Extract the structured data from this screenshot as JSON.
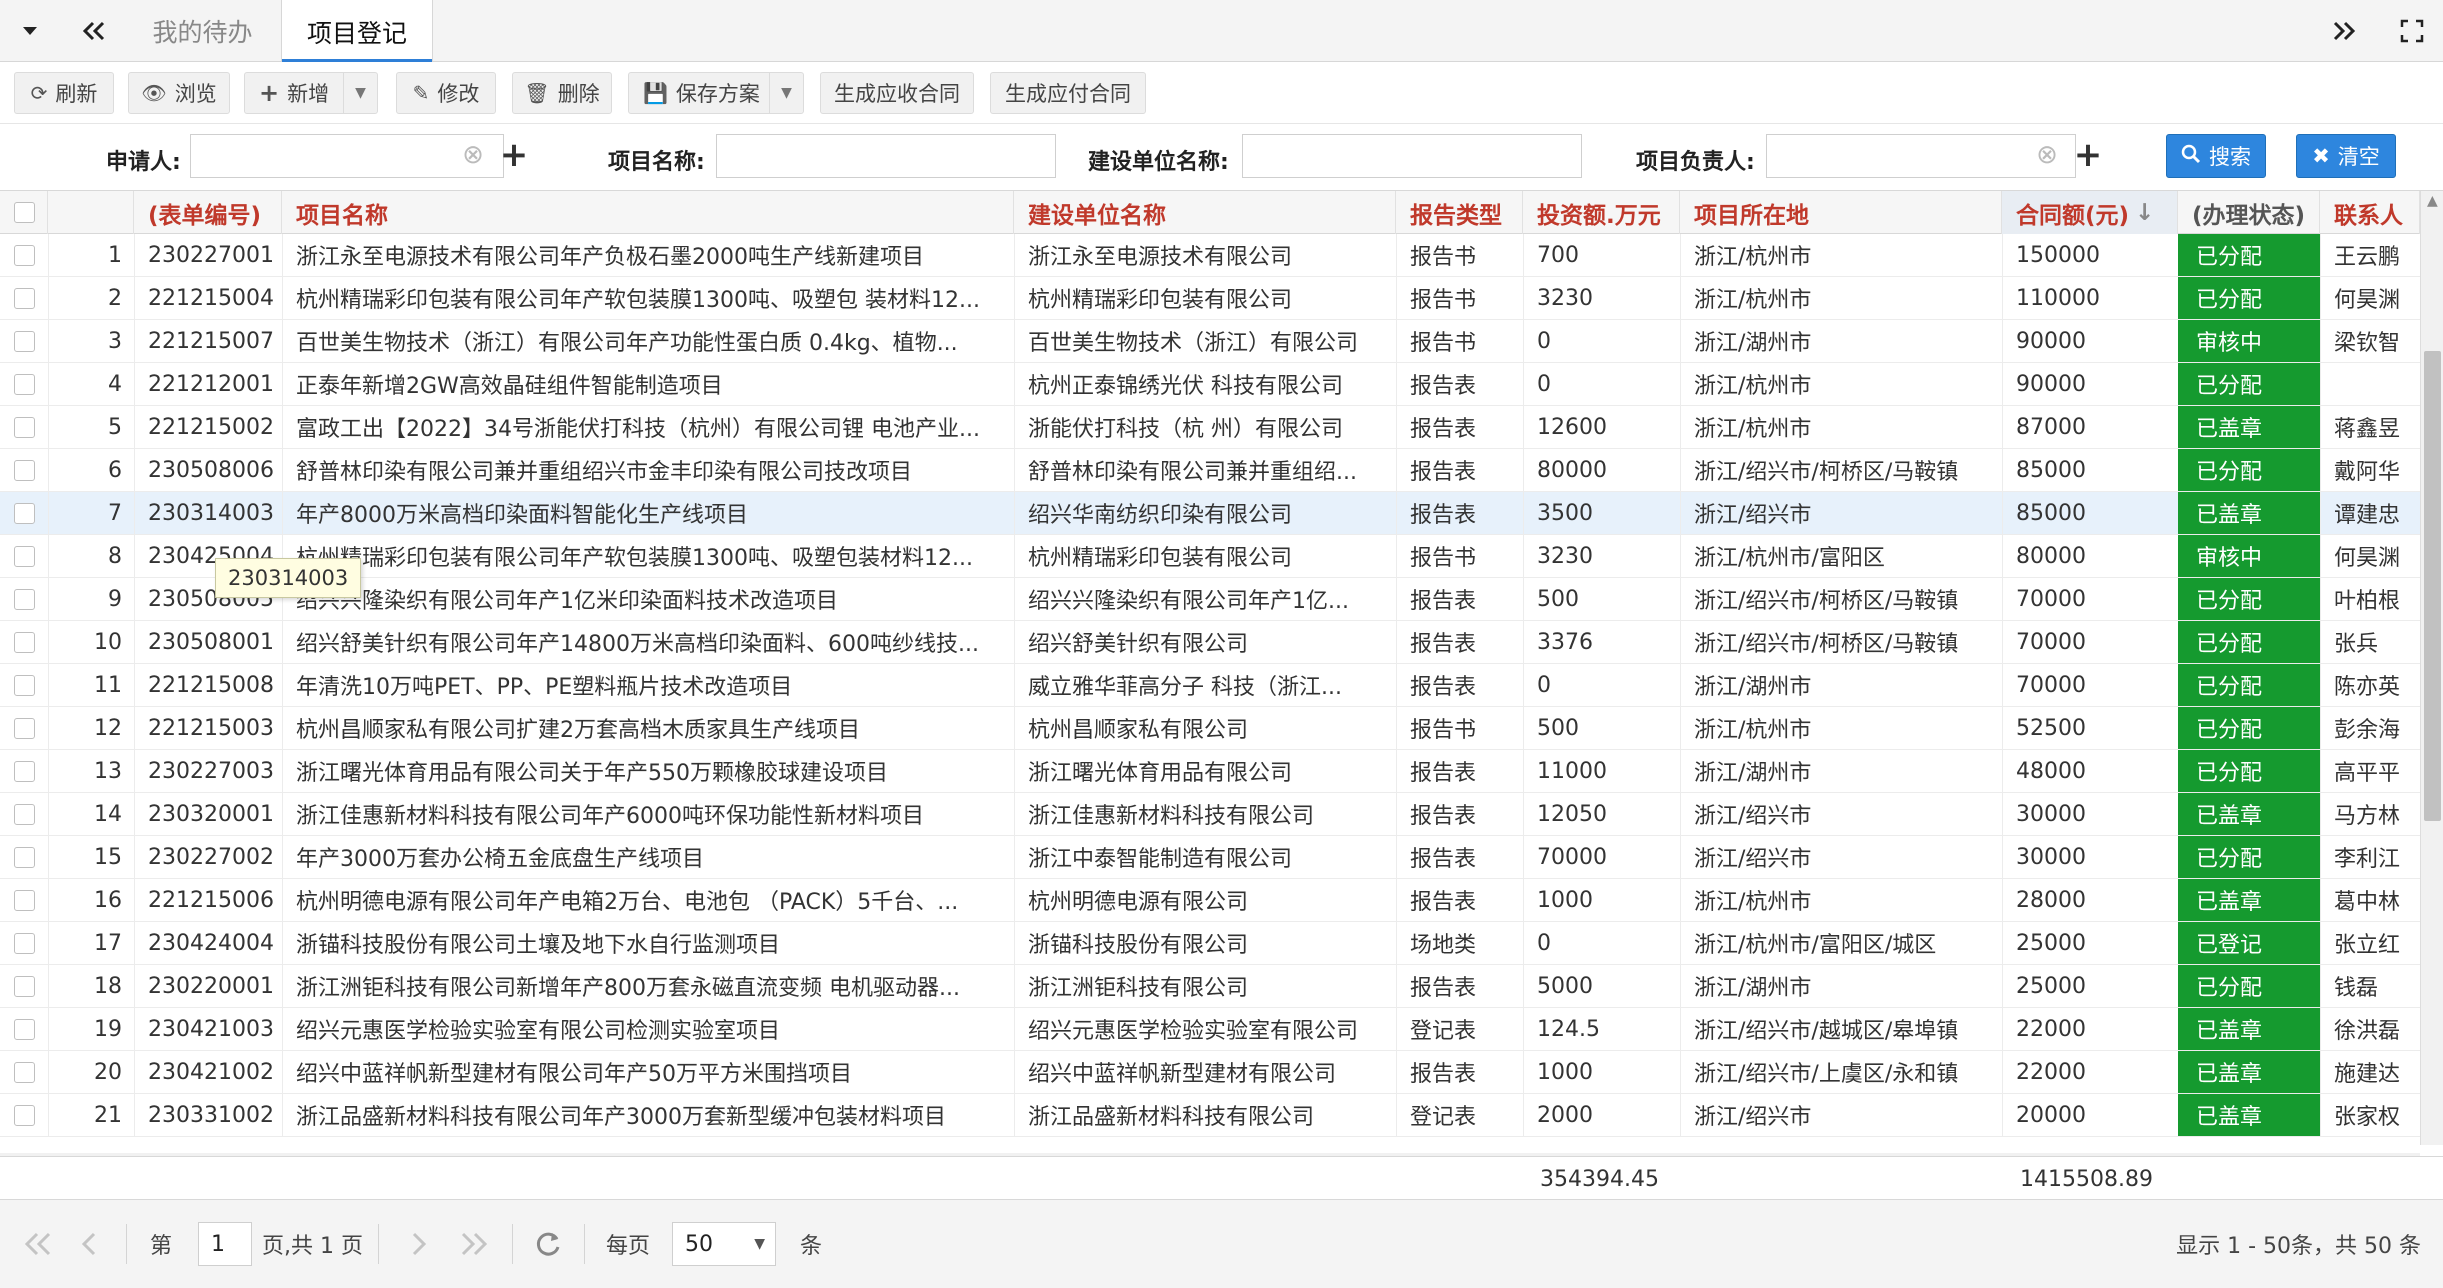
{
  "tabbar": {
    "left_icons": [
      "chevron-down-icon",
      "double-chevron-left-icon"
    ],
    "tabs": [
      {
        "label": "我的待办",
        "active": false
      },
      {
        "label": "项目登记",
        "active": true
      }
    ],
    "right_icons": [
      "double-chevron-right-icon",
      "fullscreen-icon"
    ]
  },
  "toolbar": {
    "refresh": "刷新",
    "browse": "浏览",
    "add": "新增",
    "edit": "修改",
    "delete": "删除",
    "save_plan": "保存方案",
    "gen_receivable": "生成应收合同",
    "gen_payable": "生成应付合同"
  },
  "search": {
    "applicant_label": "申请人:",
    "applicant_value": "",
    "project_name_label": "项目名称:",
    "project_name_value": "",
    "unit_name_label": "建设单位名称:",
    "unit_name_value": "",
    "manager_label": "项目负责人:",
    "manager_value": "",
    "search_btn": "搜索",
    "clear_btn": "清空"
  },
  "grid": {
    "columns": [
      "(表单编号)",
      "项目名称",
      "建设单位名称",
      "报告类型",
      "投资额.万元",
      "项目所在地",
      "合同额(元)",
      "(办理状态)",
      "联系人"
    ],
    "sort_indicator": "↓",
    "status_color": "#159a2f",
    "rows": [
      {
        "idx": "1",
        "code": "230227001",
        "name": "浙江永至电源技术有限公司年产负极石墨2000吨生产线新建项目",
        "unit": "浙江永至电源技术有限公司",
        "type": "报告书",
        "invest": "700",
        "loc": "浙江/杭州市",
        "amount": "150000",
        "status": "已分配",
        "contact": "王云鹏"
      },
      {
        "idx": "2",
        "code": "221215004",
        "name": "杭州精瑞彩印包装有限公司年产软包装膜1300吨、吸塑包 装材料12...",
        "unit": "杭州精瑞彩印包装有限公司",
        "type": "报告书",
        "invest": "3230",
        "loc": "浙江/杭州市",
        "amount": "110000",
        "status": "已分配",
        "contact": "何昊渊"
      },
      {
        "idx": "3",
        "code": "221215007",
        "name": "百世美生物技术（浙江）有限公司年产功能性蛋白质 0.4kg、植物...",
        "unit": "百世美生物技术（浙江）有限公司",
        "type": "报告书",
        "invest": "0",
        "loc": "浙江/湖州市",
        "amount": "90000",
        "status": "审核中",
        "contact": "梁钦智"
      },
      {
        "idx": "4",
        "code": "221212001",
        "name": "正泰年新增2GW高效晶硅组件智能制造项目",
        "unit": "杭州正泰锦绣光伏 科技有限公司",
        "type": "报告表",
        "invest": "0",
        "loc": "浙江/杭州市",
        "amount": "90000",
        "status": "已分配",
        "contact": ""
      },
      {
        "idx": "5",
        "code": "221215002",
        "name": "富政工出【2022】34号浙能伏打科技（杭州）有限公司锂 电池产业...",
        "unit": "浙能伏打科技（杭 州）有限公司",
        "type": "报告表",
        "invest": "12600",
        "loc": "浙江/杭州市",
        "amount": "87000",
        "status": "已盖章",
        "contact": "蒋鑫昱"
      },
      {
        "idx": "6",
        "code": "230508006",
        "name": "舒普林印染有限公司兼并重组绍兴市金丰印染有限公司技改项目",
        "unit": "舒普林印染有限公司兼并重组绍...",
        "type": "报告表",
        "invest": "80000",
        "loc": "浙江/绍兴市/柯桥区/马鞍镇",
        "amount": "85000",
        "status": "已分配",
        "contact": "戴阿华"
      },
      {
        "idx": "7",
        "code": "230314003",
        "name": "年产8000万米高档印染面料智能化生产线项目",
        "unit": "绍兴华南纺织印染有限公司",
        "type": "报告表",
        "invest": "3500",
        "loc": "浙江/绍兴市",
        "amount": "85000",
        "status": "已盖章",
        "contact": "谭建忠"
      },
      {
        "idx": "8",
        "code": "230425004",
        "name": "杭州精瑞彩印包装有限公司年产软包装膜1300吨、吸塑包装材料12...",
        "unit": "杭州精瑞彩印包装有限公司",
        "type": "报告书",
        "invest": "3230",
        "loc": "浙江/杭州市/富阳区",
        "amount": "80000",
        "status": "审核中",
        "contact": "何昊渊"
      },
      {
        "idx": "9",
        "code": "230508005",
        "name": "绍兴兴隆染织有限公司年产1亿米印染面料技术改造项目",
        "unit": "绍兴兴隆染织有限公司年产1亿...",
        "type": "报告表",
        "invest": "500",
        "loc": "浙江/绍兴市/柯桥区/马鞍镇",
        "amount": "70000",
        "status": "已分配",
        "contact": "叶柏根"
      },
      {
        "idx": "10",
        "code": "230508001",
        "name": "绍兴舒美针织有限公司年产14800万米高档印染面料、600吨纱线技...",
        "unit": "绍兴舒美针织有限公司",
        "type": "报告表",
        "invest": "3376",
        "loc": "浙江/绍兴市/柯桥区/马鞍镇",
        "amount": "70000",
        "status": "已分配",
        "contact": "张兵"
      },
      {
        "idx": "11",
        "code": "221215008",
        "name": "年清洗10万吨PET、PP、PE塑料瓶片技术改造项目",
        "unit": "威立雅华菲高分子 科技（浙江...",
        "type": "报告表",
        "invest": "0",
        "loc": "浙江/湖州市",
        "amount": "70000",
        "status": "已分配",
        "contact": "陈亦英"
      },
      {
        "idx": "12",
        "code": "221215003",
        "name": "杭州昌顺家私有限公司扩建2万套高档木质家具生产线项目",
        "unit": "杭州昌顺家私有限公司",
        "type": "报告书",
        "invest": "500",
        "loc": "浙江/杭州市",
        "amount": "52500",
        "status": "已分配",
        "contact": "彭余海"
      },
      {
        "idx": "13",
        "code": "230227003",
        "name": "浙江曙光体育用品有限公司关于年产550万颗橡胶球建设项目",
        "unit": "浙江曙光体育用品有限公司",
        "type": "报告表",
        "invest": "11000",
        "loc": "浙江/湖州市",
        "amount": "48000",
        "status": "已分配",
        "contact": "高平平"
      },
      {
        "idx": "14",
        "code": "230320001",
        "name": "浙江佳惠新材料科技有限公司年产6000吨环保功能性新材料项目",
        "unit": "浙江佳惠新材料科技有限公司",
        "type": "报告表",
        "invest": "12050",
        "loc": "浙江/绍兴市",
        "amount": "30000",
        "status": "已盖章",
        "contact": "马方林"
      },
      {
        "idx": "15",
        "code": "230227002",
        "name": "年产3000万套办公椅五金底盘生产线项目",
        "unit": "浙江中泰智能制造有限公司",
        "type": "报告表",
        "invest": "70000",
        "loc": "浙江/绍兴市",
        "amount": "30000",
        "status": "已分配",
        "contact": "李利江"
      },
      {
        "idx": "16",
        "code": "221215006",
        "name": "杭州明德电源有限公司年产电箱2万台、电池包 （PACK）5千台、...",
        "unit": "杭州明德电源有限公司",
        "type": "报告表",
        "invest": "1000",
        "loc": "浙江/杭州市",
        "amount": "28000",
        "status": "已盖章",
        "contact": "葛中林"
      },
      {
        "idx": "17",
        "code": "230424004",
        "name": "浙锚科技股份有限公司土壤及地下水自行监测项目",
        "unit": "浙锚科技股份有限公司",
        "type": "场地类",
        "invest": "0",
        "loc": "浙江/杭州市/富阳区/城区",
        "amount": "25000",
        "status": "已登记",
        "contact": "张立红"
      },
      {
        "idx": "18",
        "code": "230220001",
        "name": "浙江洲钜科技有限公司新增年产800万套永磁直流变频 电机驱动器...",
        "unit": "浙江洲钜科技有限公司",
        "type": "报告表",
        "invest": "5000",
        "loc": "浙江/湖州市",
        "amount": "25000",
        "status": "已分配",
        "contact": "钱磊"
      },
      {
        "idx": "19",
        "code": "230421003",
        "name": "绍兴元惠医学检验实验室有限公司检测实验室项目",
        "unit": "绍兴元惠医学检验实验室有限公司",
        "type": "登记表",
        "invest": "124.5",
        "loc": "浙江/绍兴市/越城区/皋埠镇",
        "amount": "22000",
        "status": "已盖章",
        "contact": "徐洪磊"
      },
      {
        "idx": "20",
        "code": "230421002",
        "name": "绍兴中蓝祥帆新型建材有限公司年产50万平方米围挡项目",
        "unit": "绍兴中蓝祥帆新型建材有限公司",
        "type": "报告表",
        "invest": "1000",
        "loc": "浙江/绍兴市/上虞区/永和镇",
        "amount": "22000",
        "status": "已盖章",
        "contact": "施建达"
      },
      {
        "idx": "21",
        "code": "230331002",
        "name": "浙江品盛新材料科技有限公司年产3000万套新型缓冲包装材料项目",
        "unit": "浙江品盛新材料科技有限公司",
        "type": "登记表",
        "invest": "2000",
        "loc": "浙江/绍兴市",
        "amount": "20000",
        "status": "已盖章",
        "contact": "张家权"
      }
    ]
  },
  "tooltip": {
    "text": "230314003"
  },
  "summary": {
    "invest_total": "354394.45",
    "amount_total": "1415508.89"
  },
  "pager": {
    "page_prefix": "第",
    "page_value": "1",
    "page_suffix": "页,共 1 页",
    "per_page_label": "每页",
    "per_page_value": "50",
    "per_page_unit": "条",
    "info": "显示 1 - 50条，共 50 条"
  }
}
